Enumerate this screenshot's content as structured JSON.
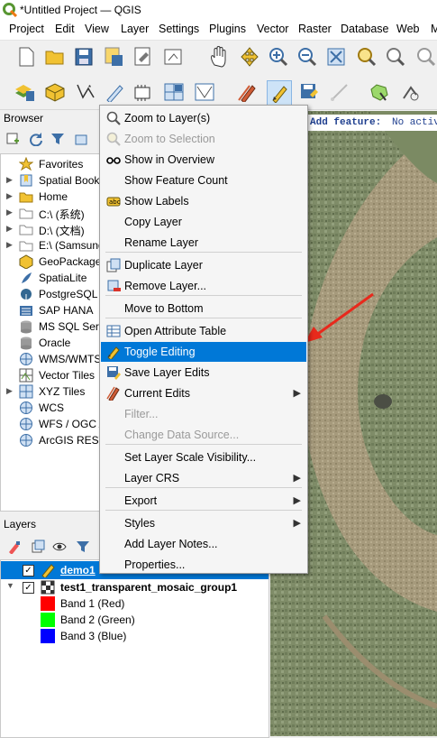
{
  "window": {
    "title": "*Untitled Project — QGIS"
  },
  "menubar": [
    "Project",
    "Edit",
    "View",
    "Layer",
    "Settings",
    "Plugins",
    "Vector",
    "Raster",
    "Database",
    "Web",
    "M"
  ],
  "browser": {
    "title": "Browser",
    "items": [
      "Favorites",
      "Spatial Bookm",
      "Home",
      "C:\\ (系统)",
      "D:\\ (文档)",
      "E:\\ (Samsung",
      "GeoPackage",
      "SpatiaLite",
      "PostgreSQL",
      "SAP HANA",
      "MS SQL Serve",
      "Oracle",
      "WMS/WMTS",
      "Vector Tiles",
      "XYZ Tiles",
      "WCS",
      "WFS / OGC A",
      "ArcGIS REST S"
    ]
  },
  "layers": {
    "title": "Layers",
    "rows": [
      {
        "label": "demo1"
      },
      {
        "label": "test1_transparent_mosaic_group1"
      },
      {
        "label": "Band 1 (Red)",
        "color": "#ff0000"
      },
      {
        "label": "Band 2 (Green)",
        "color": "#00ff00"
      },
      {
        "label": "Band 3 (Blue)",
        "color": "#0000ff"
      }
    ]
  },
  "map": {
    "add_feature_label": "Add feature:",
    "add_feature_status": "No activ"
  },
  "context_menu": {
    "items": [
      {
        "label": "Zoom to Layer(s)",
        "icon": "zoom-layer-icon"
      },
      {
        "label": "Zoom to Selection",
        "icon": "zoom-selection-icon",
        "disabled": true
      },
      {
        "label": "Show in Overview",
        "icon": "overview-icon"
      },
      {
        "label": "Show Feature Count"
      },
      {
        "label": "Show Labels",
        "icon": "labels-icon"
      },
      {
        "label": "Copy Layer"
      },
      {
        "label": "Rename Layer"
      },
      {
        "label": "Duplicate Layer",
        "icon": "duplicate-icon"
      },
      {
        "label": "Remove Layer...",
        "icon": "remove-layer-icon"
      },
      {
        "label": "Move to Bottom"
      },
      {
        "label": "Open Attribute Table",
        "icon": "table-icon"
      },
      {
        "label": "Toggle Editing",
        "icon": "pencil-icon",
        "highlighted": true
      },
      {
        "label": "Save Layer Edits",
        "icon": "save-edits-icon"
      },
      {
        "label": "Current Edits",
        "icon": "current-edits-icon",
        "submenu": true
      },
      {
        "label": "Filter...",
        "disabled": true
      },
      {
        "label": "Change Data Source...",
        "disabled": true
      },
      {
        "label": "Set Layer Scale Visibility..."
      },
      {
        "label": "Layer CRS",
        "submenu": true
      },
      {
        "label": "Export",
        "submenu": true
      },
      {
        "label": "Styles",
        "submenu": true
      },
      {
        "label": "Add Layer Notes..."
      },
      {
        "label": "Properties..."
      }
    ]
  },
  "colors": {
    "highlight": "#0078d7",
    "arrow": "#e8291c"
  }
}
